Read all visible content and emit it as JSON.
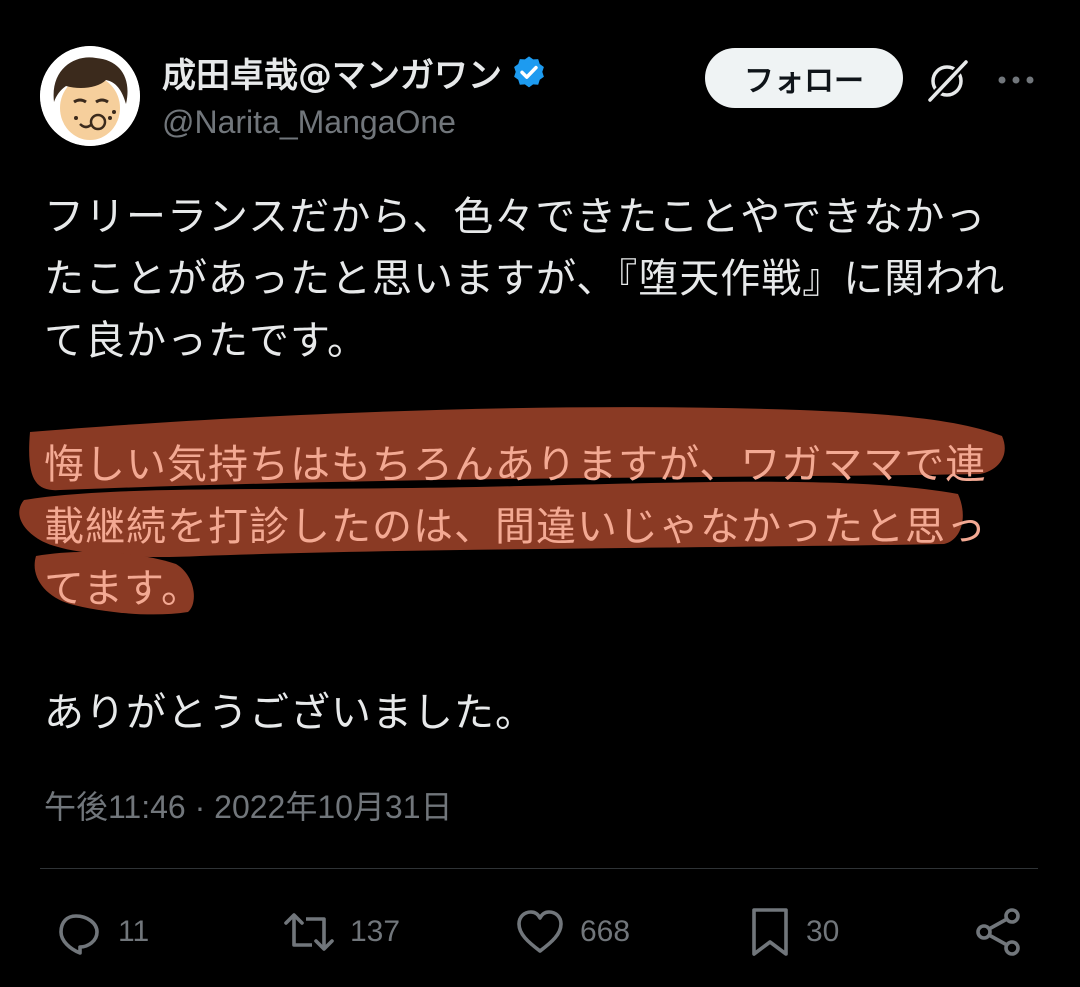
{
  "user": {
    "display_name": "成田卓哉@マンガワン",
    "handle": "@Narita_MangaOne",
    "verified": true
  },
  "header": {
    "follow_label": "フォロー"
  },
  "tweet": {
    "paragraphs": [
      {
        "lines": [
          "フリーランスだから、色々できたことやできなかっ",
          "たことがあったと思いますが、『堕天作戦』に関われ",
          "て良かったです。"
        ]
      },
      {
        "highlighted": true,
        "lines": [
          "悔しい気持ちはもちろんありますが、ワガママで連",
          "載継続を打診したのは、間違いじゃなかったと思っ",
          "てます。"
        ]
      },
      {
        "lines": [
          "ありがとうございました。"
        ]
      }
    ],
    "timestamp": "午後11:46 · 2022年10月31日"
  },
  "actions": {
    "replies": "11",
    "retweets": "137",
    "likes": "668",
    "bookmarks": "30"
  },
  "colors": {
    "background": "#000000",
    "text": "#e7e9ea",
    "muted": "#71767b",
    "verified": "#1d9bf0",
    "highlight_marker": "#8a3a24"
  }
}
